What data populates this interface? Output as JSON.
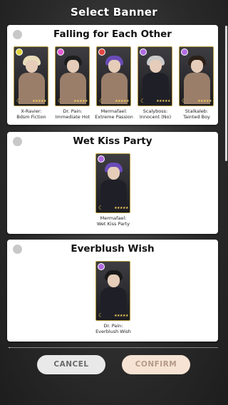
{
  "header": {
    "title": "Select Banner"
  },
  "banners": [
    {
      "title": "Falling for Each Other",
      "cards": [
        {
          "line1": "X-Ravier:",
          "line2": "Bdsm Fiction",
          "badge_color": "#e0d53a"
        },
        {
          "line1": "Dr. Pain:",
          "line2": "Immediate Hot",
          "badge_color": "#e35ad2"
        },
        {
          "line1": "Mermafael:",
          "line2": "Extreme Passion",
          "badge_color": "#e34646"
        },
        {
          "line1": "Scalyboss:",
          "line2": "Innocent (No)",
          "badge_color": "#b06be0"
        },
        {
          "line1": "Stalkaleb:",
          "line2": "Tainted Boy",
          "badge_color": "#b06be0"
        }
      ]
    },
    {
      "title": "Wet Kiss Party",
      "cards": [
        {
          "line1": "Mermafael:",
          "line2": "Wet Kiss Party",
          "badge_color": "#b06be0"
        }
      ]
    },
    {
      "title": "Everblush Wish",
      "cards": [
        {
          "line1": "Dr. Pain:",
          "line2": "Everblush Wish",
          "badge_color": "#b06be0"
        }
      ]
    }
  ],
  "card_icons": {
    "moon": "☾",
    "stars": "★★★★★"
  },
  "buttons": {
    "cancel": "CANCEL",
    "confirm": "CONFIRM"
  }
}
